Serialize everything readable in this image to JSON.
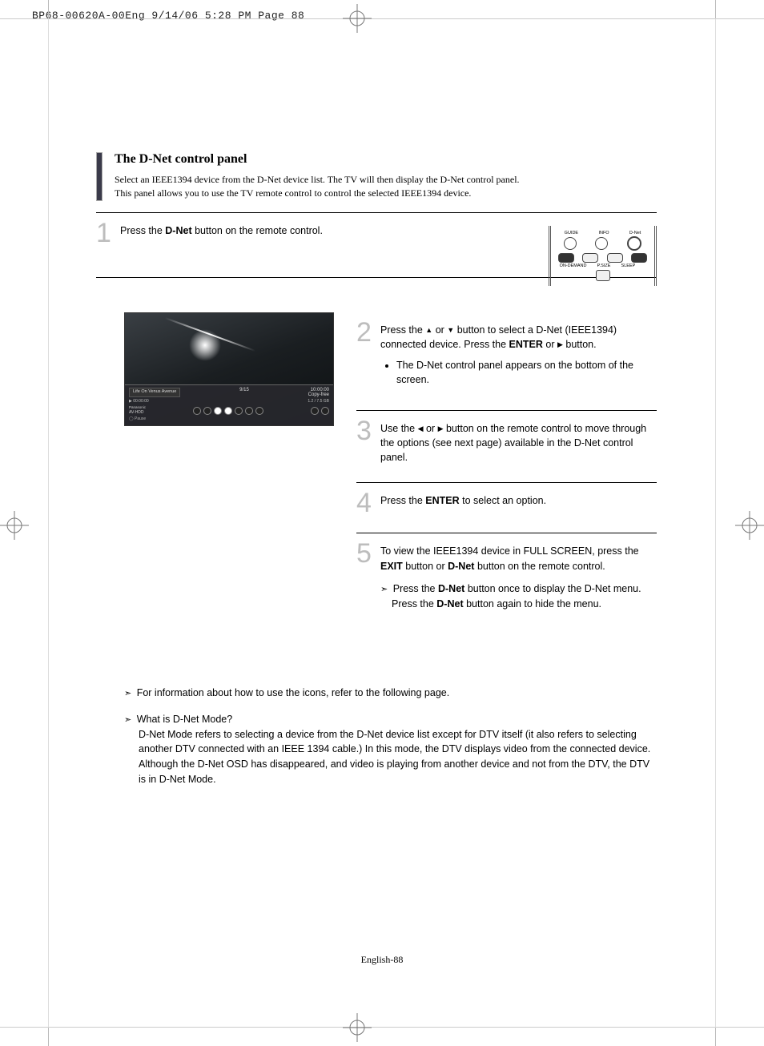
{
  "meta": {
    "header": "BP68-00620A-00Eng  9/14/06  5:28 PM  Page 88"
  },
  "title": "The D-Net control panel",
  "intro": {
    "line1": "Select an IEEE1394 device from the D-Net device list. The TV will then display the D-Net control panel.",
    "line2": "This panel allows you to use the TV remote control to control the selected IEEE1394 device."
  },
  "steps": [
    {
      "num": "1",
      "pre": "Press the ",
      "bold1": "D-Net",
      "post": " button on the remote control."
    },
    {
      "num": "2",
      "p1": "Press the ",
      "or": " or ",
      "p2": " button to select a D-Net (IEEE1394) connected device. Press the ",
      "bold1": "ENTER",
      "p3": " or ",
      "p4": " button.",
      "bullet": "The D-Net control panel appears on the bottom of the screen."
    },
    {
      "num": "3",
      "p1": "Use the ",
      "or": " or ",
      "p2": " button on the remote control to move through the options (see next page) available in the D-Net control panel."
    },
    {
      "num": "4",
      "p1": "Press the ",
      "bold1": "ENTER",
      "p2": " to select an option."
    },
    {
      "num": "5",
      "p1": "To view the IEEE1394 device in FULL SCREEN, press the ",
      "bold1": "EXIT",
      "p2": " button or ",
      "bold2": "D-Net",
      "p3": " button on the remote control.",
      "note_p1": "Press the ",
      "note_b1": "D-Net",
      "note_p2": " button once to display the D-Net menu.",
      "note_p3": "Press the ",
      "note_b2": "D-Net",
      "note_p4": " button again to hide the menu."
    }
  ],
  "remote": {
    "labels": [
      "GUIDE",
      "INFO",
      "D-Net",
      "ON-DEMAND",
      "P.SIZE",
      "SLEEP"
    ]
  },
  "panel": {
    "program": "Life On Venus Avenue",
    "date": "9/15",
    "time": "10:00:00",
    "copy": "Copy-free",
    "elapsed": "00:00:00",
    "size": "1.2 / 7.5 GB",
    "device_label": "Panasonic",
    "device": "AV-HDD",
    "status": "Pause"
  },
  "notes": [
    "For information about how to use the icons, refer to the following page.",
    {
      "title": "What is D-Net Mode?",
      "body": "D-Net Mode refers to selecting a device from the D-Net device list except for DTV itself (it also refers to selecting another DTV connected with an IEEE 1394 cable.) In this mode, the DTV displays video from the connected device. Although the D-Net OSD has disappeared, and video is playing from another device and not from the DTV, the DTV is in D-Net Mode."
    }
  ],
  "page_num": "English-88"
}
